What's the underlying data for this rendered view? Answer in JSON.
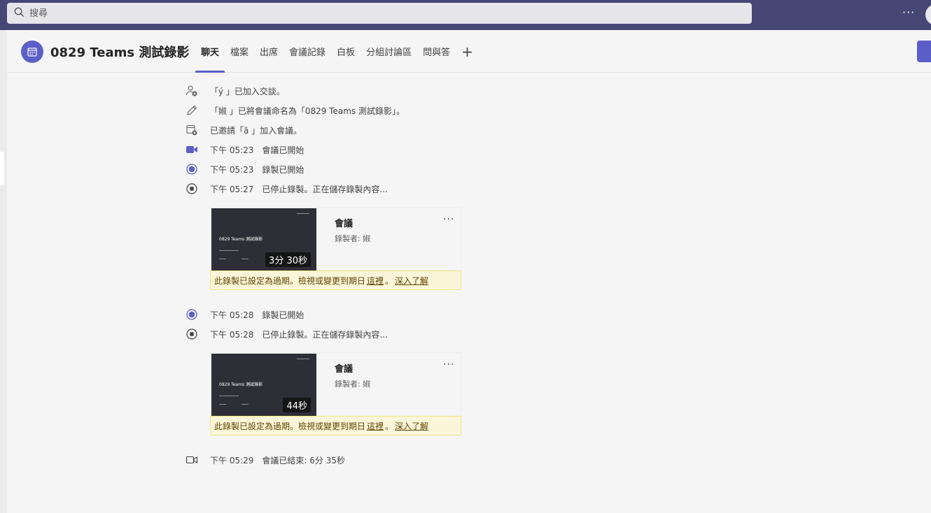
{
  "search": {
    "placeholder": "搜尋"
  },
  "topbar": {
    "more_label": "···"
  },
  "meeting": {
    "title": "0829 Teams 測試錄影",
    "tabs": [
      "聊天",
      "檔案",
      "出席",
      "會議記錄",
      "白板",
      "分組討論區",
      "問與答"
    ],
    "add_tab_label": "+"
  },
  "events": [
    {
      "icon": "person-add-icon",
      "time": "",
      "text": "「ý        」已加入交談。"
    },
    {
      "icon": "pencil-icon",
      "time": "",
      "text": "「婌        」已將會議命名為「0829 Teams 測試錄影」。"
    },
    {
      "icon": "calendar-add-icon",
      "time": "",
      "text": "已邀請「ã        」加入會議。"
    },
    {
      "icon": "video-camera-icon",
      "time": "下午 05:23",
      "text": "會議已開始"
    },
    {
      "icon": "record-icon",
      "time": "下午 05:23",
      "text": "錄製已開始"
    },
    {
      "icon": "stop-record-icon",
      "time": "下午 05:27",
      "text": "已停止錄製。正在儲存錄製內容..."
    },
    {
      "icon": "record-icon",
      "time": "下午 05:28",
      "text": "錄製已開始"
    },
    {
      "icon": "stop-record-icon",
      "time": "下午 05:28",
      "text": "已停止錄製。正在儲存錄製內容..."
    },
    {
      "icon": "video-camera-outline-icon",
      "time": "下午 05:29",
      "text": "會議已結束: 6分 35秒"
    }
  ],
  "recordings": [
    {
      "thumbnail_title": "0829 Teams 測試錄影",
      "duration": "3分 30秒",
      "name": "會議",
      "recorded_by": "錄製者: 婌",
      "more_label": "···",
      "notice": "此錄製已設定為過期。檢視或變更到期日",
      "notice_link_here": "這裡",
      "notice_sep": "。",
      "notice_link_learn": "深入了解"
    },
    {
      "thumbnail_title": "0829 Teams 測試錄影",
      "duration": "44秒",
      "name": "會議",
      "recorded_by": "錄製者: 婌",
      "more_label": "···",
      "notice": "此錄製已設定為過期。檢視或變更到期日",
      "notice_link_here": "這裡",
      "notice_sep": "。",
      "notice_link_learn": "深入了解"
    }
  ],
  "colors": {
    "topbar": "#464775",
    "accent": "#5b5fc7",
    "notice_bg": "#fbf6d9",
    "notice_border": "#f2e384"
  }
}
